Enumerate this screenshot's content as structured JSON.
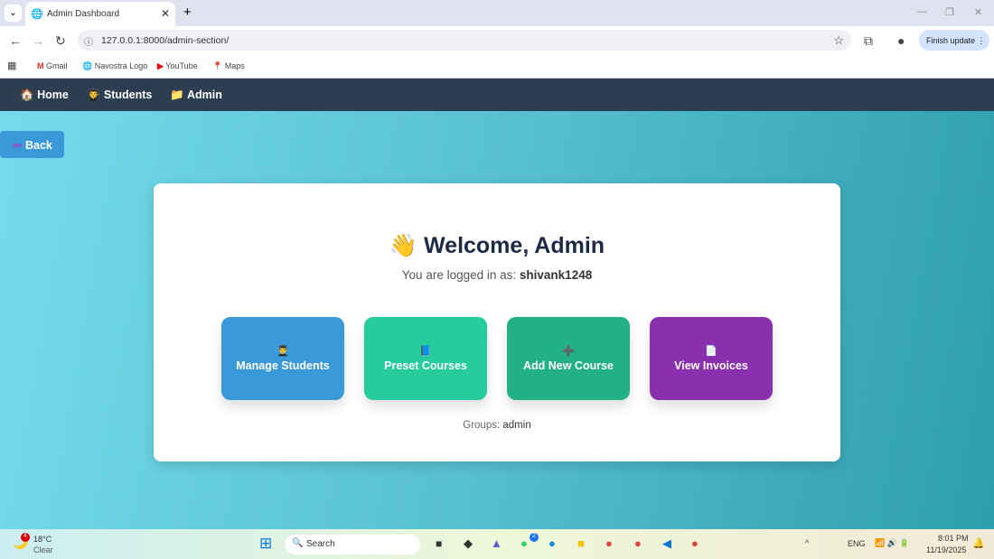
{
  "browser": {
    "tab_title": "Admin Dashboard",
    "url": "127.0.0.1:8000/admin-section/",
    "finish_update": "Finish update",
    "bookmarks": [
      "Gmail",
      "Navostra Logo",
      "YouTube",
      "Maps"
    ]
  },
  "nav": {
    "items": [
      {
        "icon": "🏠",
        "label": "Home"
      },
      {
        "icon": "👨‍🎓",
        "label": "Students"
      },
      {
        "icon": "📁",
        "label": "Admin"
      }
    ]
  },
  "back": {
    "icon": "⬅",
    "label": "Back"
  },
  "card": {
    "wave": "👋",
    "title": "Welcome, Admin",
    "logged_prefix": "You are logged in as:",
    "username": "shivank1248",
    "tiles": [
      {
        "icon": "👨‍🎓",
        "label": "Manage Students",
        "color": "#3a9ad9"
      },
      {
        "icon": "📘",
        "label": "Preset Courses",
        "color": "#26cc9b"
      },
      {
        "icon": "➕",
        "label": "Add New Course",
        "color": "#22b185"
      },
      {
        "icon": "📄",
        "label": "View Invoices",
        "color": "#8a2fae"
      }
    ],
    "groups_prefix": "Groups:",
    "groups": "admin"
  },
  "taskbar": {
    "temp": "18°C",
    "weather": "Clear",
    "search": "Search",
    "lang": "ENG",
    "time": "8:01 PM",
    "date": "11/19/2025",
    "badge": "4",
    "whatsapp_badge": "2"
  }
}
